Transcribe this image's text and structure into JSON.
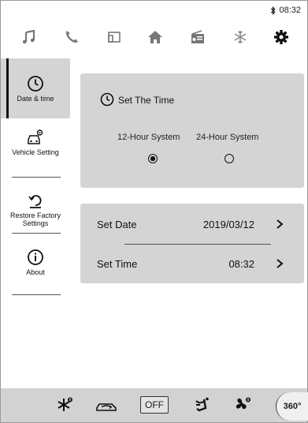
{
  "status_bar": {
    "bluetooth_icon": "bluetooth-icon",
    "time": "08:32"
  },
  "top_nav": [
    {
      "icon": "music-note-icon",
      "label": ""
    },
    {
      "icon": "phone-icon",
      "label": ""
    },
    {
      "icon": "screen-mirror-icon",
      "label": ""
    },
    {
      "icon": "home-icon",
      "label": ""
    },
    {
      "icon": "radio-icon",
      "label": ""
    },
    {
      "icon": "snowflake-icon",
      "label": ""
    },
    {
      "icon": "gear-icon",
      "label": "",
      "active": true
    }
  ],
  "sidebar": {
    "items": [
      {
        "icon": "clock-icon",
        "label": "Date & time",
        "active": true
      },
      {
        "icon": "car-settings-icon",
        "label": "Vehicle Setting"
      },
      {
        "icon": "restore-icon",
        "label": "Restore Factory Settings"
      },
      {
        "icon": "info-icon",
        "label": "About"
      }
    ]
  },
  "time_card": {
    "title": "Set The Time",
    "options": [
      {
        "label": "12-Hour System",
        "selected": true
      },
      {
        "label": "24-Hour System",
        "selected": false
      }
    ]
  },
  "date_card": {
    "rows": [
      {
        "label": "Set Date",
        "value": "2019/03/12"
      },
      {
        "label": "Set Time",
        "value": "08:32"
      }
    ]
  },
  "bottom_bar": {
    "off_label": "OFF",
    "label_360": "360°"
  },
  "colors": {
    "card_bg": "#d4d4d4",
    "bottom_bar_bg": "#d2d2d2",
    "accent": "#111111"
  }
}
